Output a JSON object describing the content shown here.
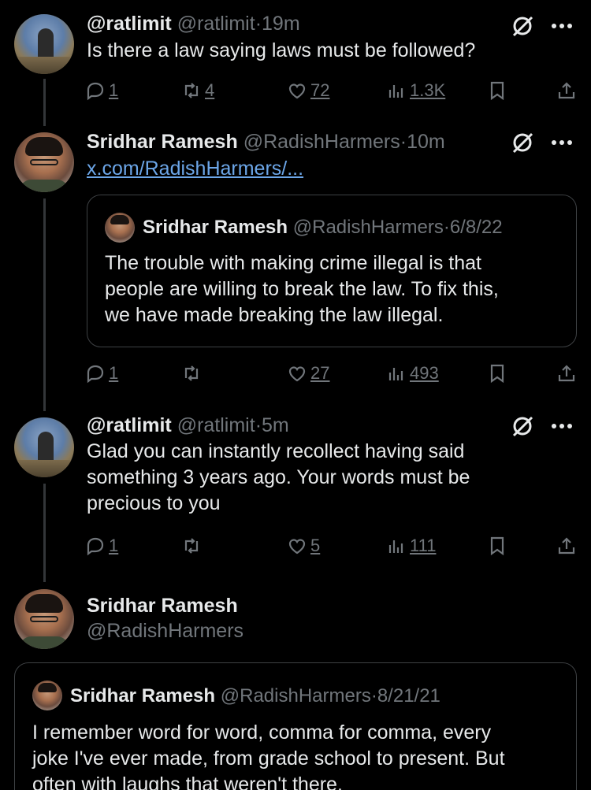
{
  "tweets": [
    {
      "name": "@ratlimit",
      "handle": "@ratlimit",
      "dot": "·",
      "time": "19m",
      "text": "Is there a law saying laws must be followed?",
      "replies": "1",
      "retweets": "4",
      "likes": "72",
      "views": "1.3K"
    },
    {
      "name": "Sridhar Ramesh",
      "handle": "@RadishHarmers",
      "dot": "·",
      "time": "10m",
      "link": "x.com/RadishHarmers/...",
      "quote": {
        "name": "Sridhar Ramesh",
        "handle": "@RadishHarmers",
        "dot": "·",
        "date": "6/8/22",
        "lines": [
          "The trouble with making crime illegal is that",
          "people are willing to break the law. To fix this,",
          "we have made breaking the law illegal."
        ]
      },
      "replies": "1",
      "retweets": "",
      "likes": "27",
      "views": "493"
    },
    {
      "name": "@ratlimit",
      "handle": "@ratlimit",
      "dot": "·",
      "time": "5m",
      "lines": [
        "Glad you can instantly recollect having said",
        "something 3 years ago. Your words must be",
        "precious to you"
      ],
      "replies": "1",
      "retweets": "",
      "likes": "5",
      "views": "111"
    },
    {
      "name": "Sridhar Ramesh",
      "handle": "@RadishHarmers",
      "quote": {
        "name": "Sridhar Ramesh",
        "handle": "@RadishHarmers",
        "dot": "·",
        "date": "8/21/21",
        "lines": [
          "I remember word for word, comma for comma, every",
          "joke I've ever made, from grade school to present. But",
          "often with laughs that weren't there."
        ]
      }
    }
  ],
  "icons": {
    "grok": "grok-icon",
    "more": "more-icon",
    "reply": "reply-icon",
    "retweet": "retweet-icon",
    "like": "heart-icon",
    "views": "views-icon",
    "bookmark": "bookmark-icon",
    "share": "share-icon"
  },
  "colors": {
    "background": "#000000",
    "text": "#e7e9ea",
    "muted": "#71767b",
    "link": "#6ca6e8",
    "border": "#3e4144"
  }
}
